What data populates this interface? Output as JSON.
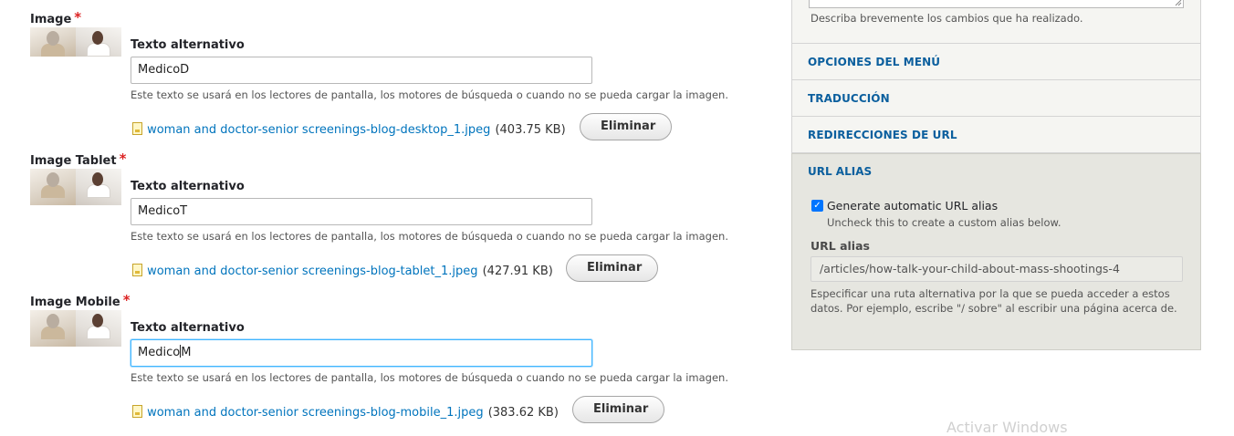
{
  "image_fields": [
    {
      "label": "Image",
      "required_mark": "*",
      "alt_label": "Texto alternativo",
      "alt_value": "MedicoD",
      "help": "Este texto se usará en los lectores de pantalla, los motores de búsqueda o cuando no se pueda cargar la imagen.",
      "file_name": "woman and doctor-senior screenings-blog-desktop_1.jpeg",
      "file_size": "(403.75 KB)",
      "remove_label": "Eliminar"
    },
    {
      "label": "Image Tablet",
      "required_mark": "*",
      "alt_label": "Texto alternativo",
      "alt_value": "MedicoT",
      "help": "Este texto se usará en los lectores de pantalla, los motores de búsqueda o cuando no se pueda cargar la imagen.",
      "file_name": "woman and doctor-senior screenings-blog-tablet_1.jpeg",
      "file_size": "(427.91 KB)",
      "remove_label": "Eliminar"
    },
    {
      "label": "Image Mobile",
      "required_mark": "*",
      "alt_label": "Texto alternativo",
      "alt_value_before_caret": "Medico",
      "alt_value_after_caret": "M",
      "help": "Este texto se usará en los lectores de pantalla, los motores de búsqueda o cuando no se pueda cargar la imagen.",
      "file_name": "woman and doctor-senior screenings-blog-mobile_1.jpeg",
      "file_size": "(383.62 KB)",
      "remove_label": "Eliminar"
    }
  ],
  "sidebar": {
    "revision_help": "Describa brevemente los cambios que ha realizado.",
    "sections": [
      "OPCIONES DEL MENÚ",
      "TRADUCCIÓN",
      "REDIRECCIONES DE URL"
    ],
    "url_alias": {
      "title": "URL ALIAS",
      "checkbox_label": "Generate automatic URL alias",
      "checkbox_checked": true,
      "checkbox_help": "Uncheck this to create a custom alias below.",
      "alias_label": "URL alias",
      "alias_value": "/articles/how-talk-your-child-about-mass-shootings-4",
      "alias_description": "Especificar una ruta alternativa por la que se pueda acceder a estos datos. Por ejemplo, escribe \"/ sobre\" al escribir una página acerca de."
    }
  },
  "watermark": "Activar Windows",
  "colors": {
    "link": "#0074bd",
    "accordion_title": "#0b5f9e",
    "required": "#dc2323",
    "focus": "#40b6ff"
  }
}
